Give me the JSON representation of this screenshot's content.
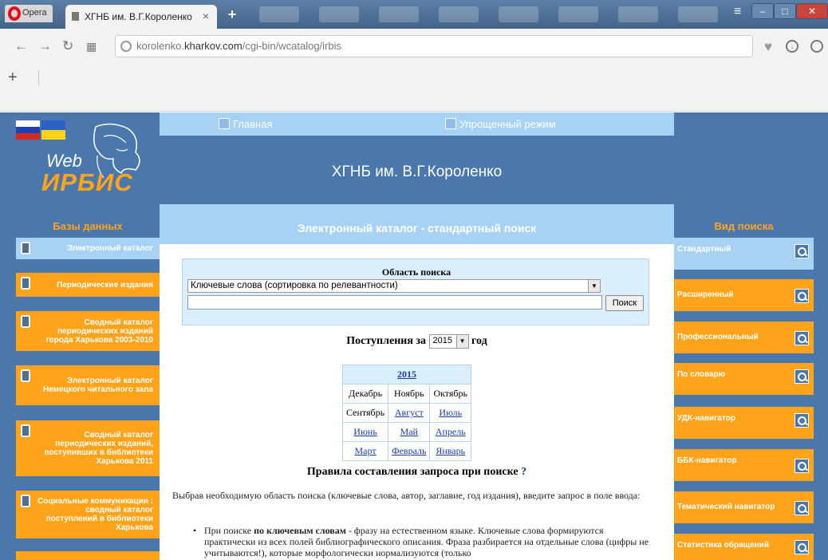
{
  "browser": {
    "opera_label": "Opera",
    "tab_title": "ХГНБ им. В.Г.Короленко",
    "tab_close": "×",
    "new_tab": "+",
    "url_prefix": "korolenko.",
    "url_domain": "kharkov.com",
    "url_path": "/cgi-bin/wcatalog/irbis",
    "bookmark_add": "+"
  },
  "logo": {
    "web": "Web",
    "irbis": "ИРБИС"
  },
  "topnav": {
    "home": "Главная",
    "simple": "Упрощенный режим"
  },
  "site_title": "ХГНБ им. В.Г.Короленко",
  "left": {
    "heading": "Базы данных",
    "items": [
      {
        "label": "Электронный каталог"
      },
      {
        "label": "Периодические издания"
      },
      {
        "label": "Сводный каталог периодических изданий города Харькова 2003-2010"
      },
      {
        "label": "Электронный каталог Немецкого читального зала"
      },
      {
        "label": "Сводный каталог периодических изданий, поступивших в библиотеки Харькова 2011"
      },
      {
        "label": "Социальные коммуникации : сводный каталог поступлений в библиотеки Харькова"
      }
    ]
  },
  "right": {
    "heading": "Вид поиска",
    "items": [
      {
        "label": "Стандартный"
      },
      {
        "label": "Расширенный"
      },
      {
        "label": "Профессиональный"
      },
      {
        "label": "По словарю"
      },
      {
        "label": "УДК-навигатор"
      },
      {
        "label": "ББК-навигатор"
      },
      {
        "label": "Тематический навигатор"
      },
      {
        "label": "Статистика обращений"
      }
    ]
  },
  "content": {
    "heading": "Электронный каталог - стандартный поиск",
    "area_title": "Область поиска",
    "area_selected": "Ключевые слова (сортировка по релевантности)",
    "query_value": "",
    "search_button": "Поиск",
    "post_prefix": "Поступления за",
    "post_year": "2015",
    "post_suffix": "год",
    "calendar": {
      "year": "2015",
      "rows": [
        [
          "Декабрь",
          "Ноябрь",
          "Октябрь"
        ],
        [
          "Сентябрь",
          "Август",
          "Июль"
        ],
        [
          "Июнь",
          "Май",
          "Апрель"
        ],
        [
          "Март",
          "Февраль",
          "Январь"
        ]
      ]
    },
    "rules_title": "Правила составления запроса при поиске",
    "rules_help": "?",
    "rules_intro": "Выбрав необходимую область поиска (ключевые слова, автор, заглавие, год издания), введите запрос в поле ввода:",
    "rule_prefix": "При поиске",
    "rule_bold": "по ключевым словам",
    "rule_text": " - фразу на естественном языке. Ключевые слова формируются практически из всех полей библиографического описания. Фраза разбирается на отдельные слова (цифры не учитываются!), которые морфологически нормализуются (только"
  }
}
